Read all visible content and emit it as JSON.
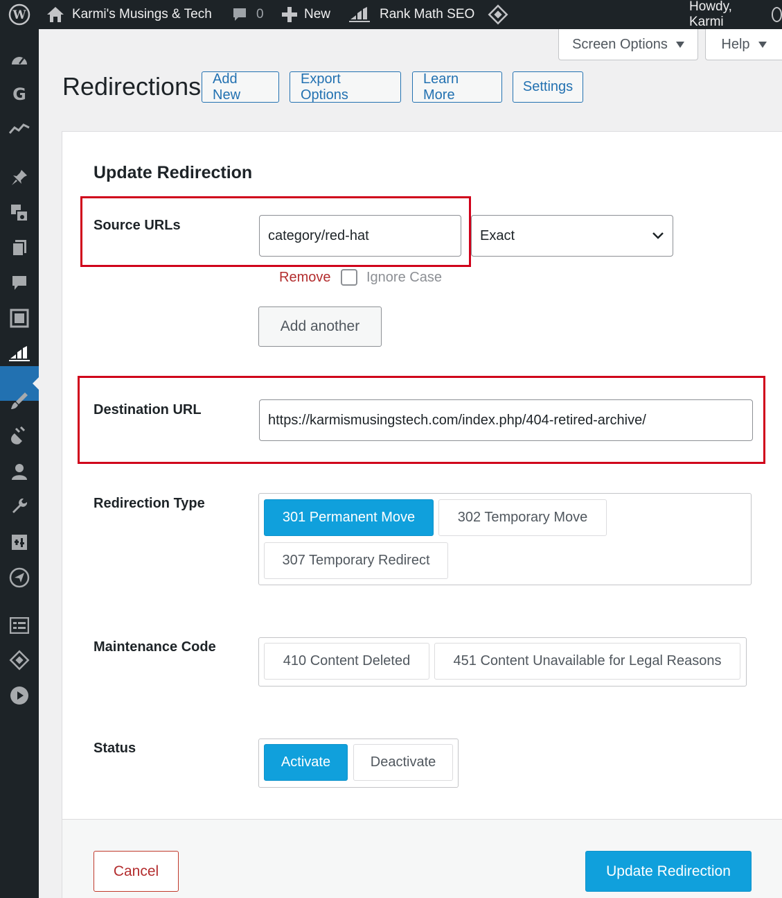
{
  "adminbar": {
    "site_name": "Karmi's Musings & Tech",
    "comments_count": "0",
    "new_label": "New",
    "plugin_label": "Rank Math SEO",
    "greeting": "Howdy, Karmi"
  },
  "meta_tabs": {
    "screen_options": "Screen Options",
    "help": "Help"
  },
  "sidebar": {
    "items": [
      "dashboard",
      "google-site-kit",
      "analytics",
      "posts",
      "media",
      "pages",
      "comments",
      "gallery",
      "rank-math",
      "appearance",
      "plugins",
      "users",
      "tools",
      "settings",
      "send",
      "forms",
      "diamond",
      "play"
    ],
    "active": "rank-math"
  },
  "header": {
    "title": "Redirections",
    "buttons": [
      "Add New",
      "Export Options",
      "Learn More",
      "Settings"
    ]
  },
  "form": {
    "title": "Update Redirection",
    "source": {
      "label": "Source URLs",
      "value": "category/red-hat",
      "match_type": "Exact",
      "remove_label": "Remove",
      "ignore_case_label": "Ignore Case",
      "add_another_label": "Add another"
    },
    "destination": {
      "label": "Destination URL",
      "value": "https://karmismusingstech.com/index.php/404-retired-archive/"
    },
    "redirection_type": {
      "label": "Redirection Type",
      "options": [
        "301 Permanent Move",
        "302 Temporary Move",
        "307 Temporary Redirect"
      ],
      "selected": "301 Permanent Move"
    },
    "maintenance_code": {
      "label": "Maintenance Code",
      "options": [
        "410 Content Deleted",
        "451 Content Unavailable for Legal Reasons"
      ]
    },
    "status": {
      "label": "Status",
      "options": [
        "Activate",
        "Deactivate"
      ],
      "selected": "Activate"
    },
    "cancel_label": "Cancel",
    "submit_label": "Update Redirection"
  },
  "colors": {
    "adminbar_bg": "#1d2327",
    "accent_blue": "#10a0dc",
    "wp_blue": "#2271b1",
    "highlight_red": "#d0021b"
  }
}
